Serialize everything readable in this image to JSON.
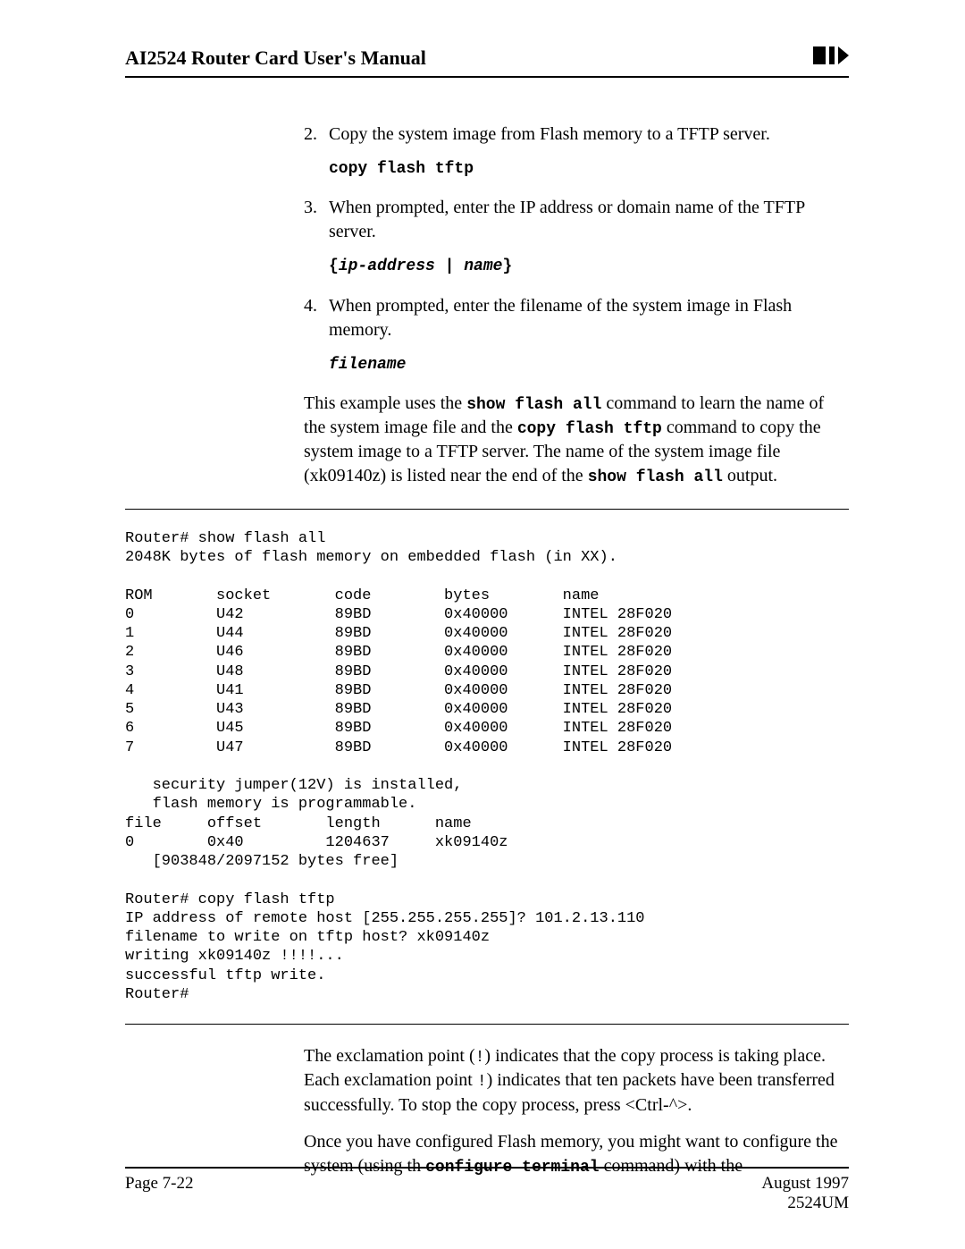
{
  "header": {
    "title": "AI2524 Router Card User's Manual"
  },
  "steps": [
    {
      "n": "2.",
      "text": "Copy the system image from Flash memory to a TFTP server.",
      "cmd_bold": "copy flash tftp"
    },
    {
      "n": "3.",
      "text": "When prompted, enter the IP address or domain name of the TFTP server.",
      "cmd_lbrace": "{",
      "cmd_italic1": "ip-address",
      "cmd_pipe": " | ",
      "cmd_italic2": "name",
      "cmd_rbrace": "}"
    },
    {
      "n": "4.",
      "text": "When prompted, enter the filename of the system image in Flash memory.",
      "cmd_italic": "filename"
    }
  ],
  "explain": {
    "p1a": "This example uses the ",
    "p1b": "show flash all",
    "p1c": " command to learn the name of the system image file and the ",
    "p1d": "copy flash tftp",
    "p1e": " command to copy the system image to a TFTP server. The name of the system image file (xk09140z) is listed near the end of the ",
    "p1f": "show flash all",
    "p1g": " output."
  },
  "terminal": "Router# show flash all\n2048K bytes of flash memory on embedded flash (in XX).\n\nROM       socket       code        bytes        name\n0         U42          89BD        0x40000      INTEL 28F020\n1         U44          89BD        0x40000      INTEL 28F020\n2         U46          89BD        0x40000      INTEL 28F020\n3         U48          89BD        0x40000      INTEL 28F020\n4         U41          89BD        0x40000      INTEL 28F020\n5         U43          89BD        0x40000      INTEL 28F020\n6         U45          89BD        0x40000      INTEL 28F020\n7         U47          89BD        0x40000      INTEL 28F020\n\n   security jumper(12V) is installed,\n   flash memory is programmable.\nfile     offset       length      name\n0        0x40         1204637     xk09140z\n   [903848/2097152 bytes free]\n\nRouter# copy flash tftp\nIP address of remote host [255.255.255.255]? 101.2.13.110\nfilename to write on tftp host? xk09140z\nwriting xk09140z !!!!...\nsuccessful tftp write.\nRouter#",
  "bottom": {
    "p1a": "The exclamation point (",
    "p1b": "!",
    "p1c": ") indicates that the copy process is taking place. Each exclamation point ",
    "p1d": "!",
    "p1e": ") indicates that ten packets have been transferred successfully. To stop the copy process, press <Ctrl-^>.",
    "p2a": "Once you have configured Flash memory, you might want to configure the system (using th  ",
    "p2b": "configure terminal",
    "p2c": " command) with the"
  },
  "footer": {
    "left": "Page 7-22",
    "right1": "August 1997",
    "right2": "2524UM"
  }
}
